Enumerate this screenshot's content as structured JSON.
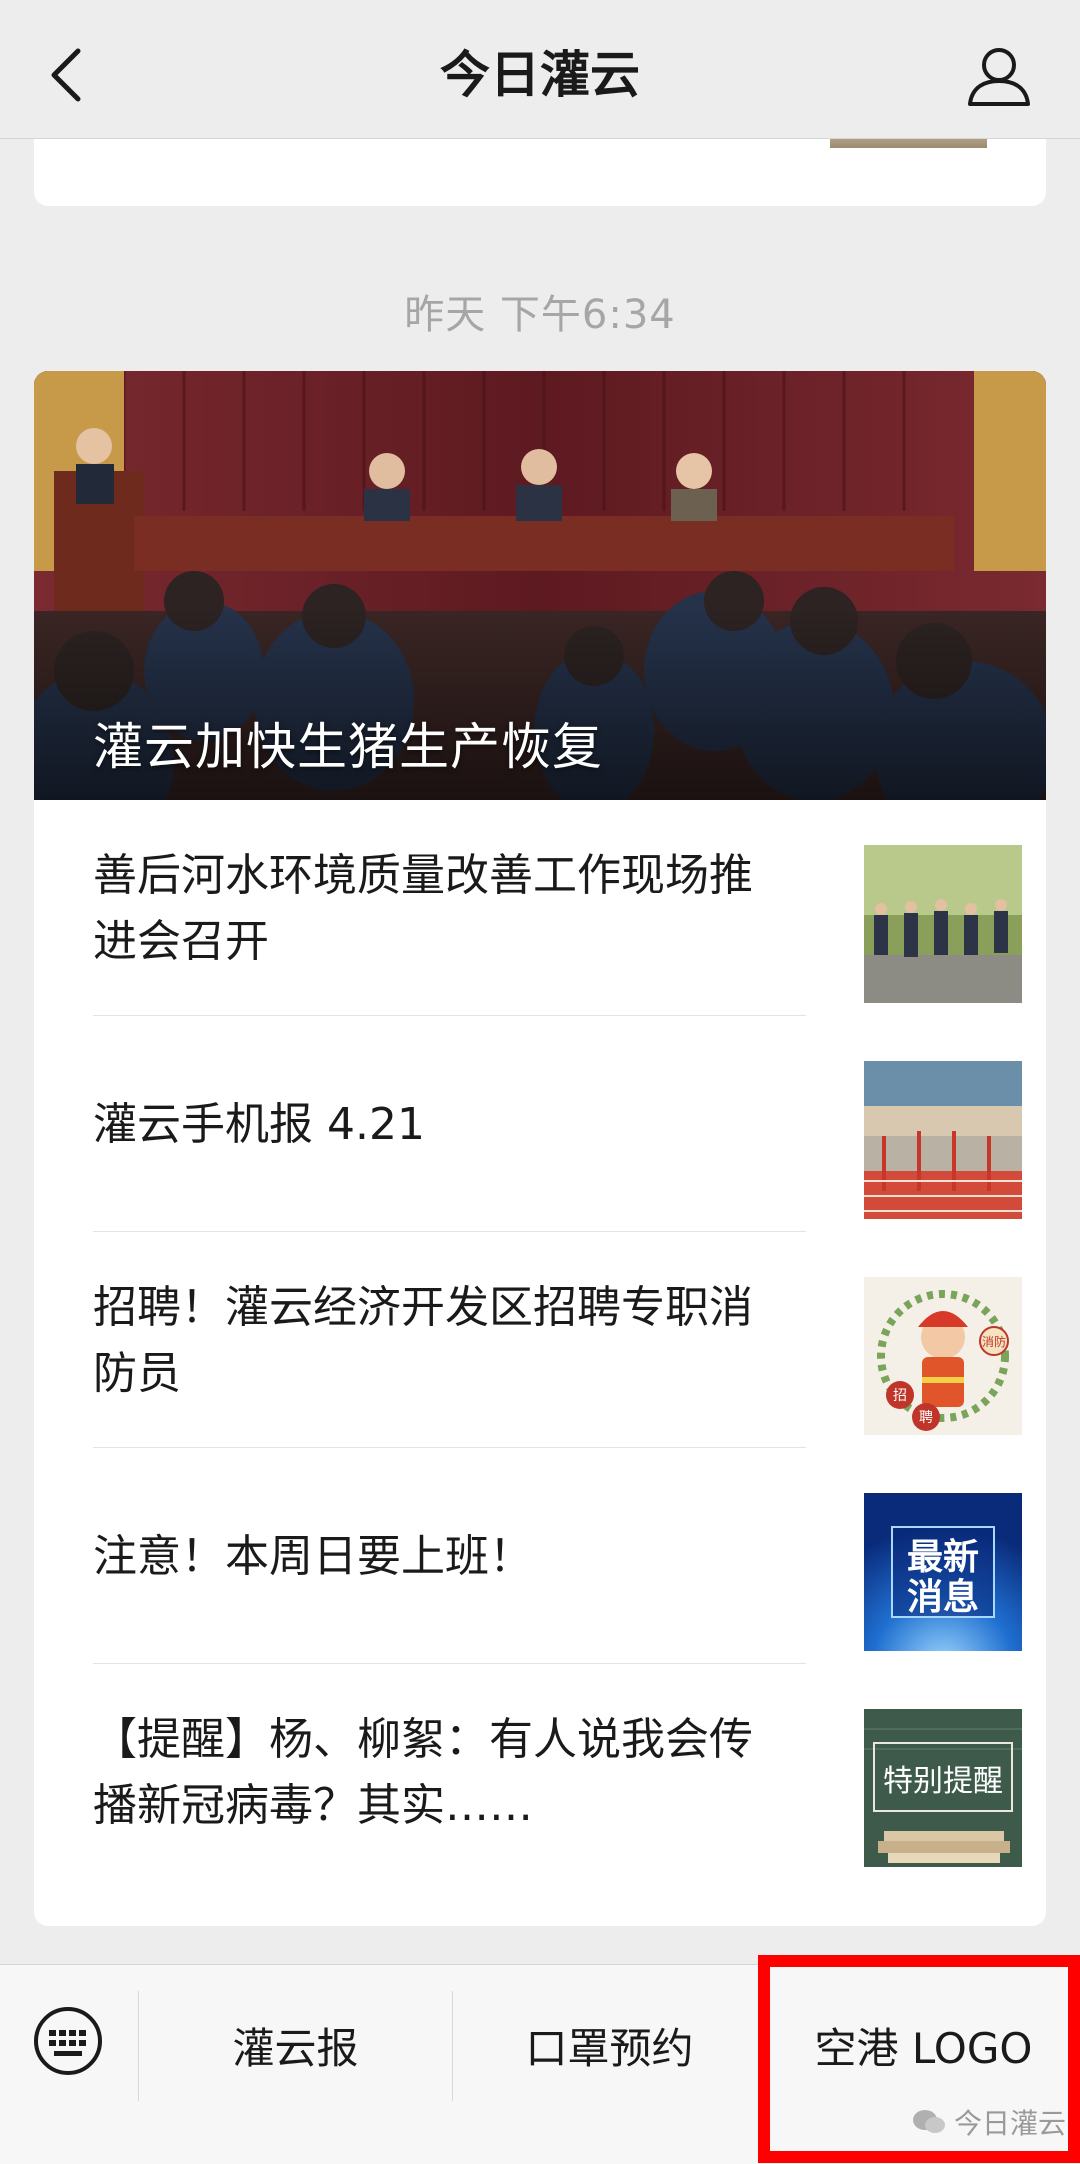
{
  "nav": {
    "title": "今日灌云",
    "back_icon": "chevron-left-icon",
    "profile_icon": "user-icon"
  },
  "timestamp": "昨天 下午6:34",
  "hero": {
    "title": "灌云加快生猪生产恢复"
  },
  "articles": [
    {
      "title": "善后河水环境质量改善工作现场推进会召开",
      "thumb": "field-inspection-photo"
    },
    {
      "title": "灌云手机报 4.21",
      "thumb": "construction-site-photo"
    },
    {
      "title": "招聘！灌云经济开发区招聘专职消防员",
      "thumb": "firefighter-recruitment-graphic",
      "badge_chars": [
        "消防",
        "招",
        "聘"
      ]
    },
    {
      "title": "注意！本周日要上班！",
      "thumb": "latest-news-graphic",
      "thumb_text": "最新消息"
    },
    {
      "title": "【提醒】杨、柳絮：有人说我会传播新冠病毒？其实……",
      "thumb": "special-reminder-graphic",
      "thumb_text": "特别提醒"
    }
  ],
  "menu": {
    "keyboard_icon": "keyboard-icon",
    "items": [
      "灌云报",
      "口罩预约",
      "空港 LOGO"
    ]
  },
  "watermark": "今日灌云",
  "colors": {
    "highlight": "#ff0000",
    "background": "#ededed"
  }
}
